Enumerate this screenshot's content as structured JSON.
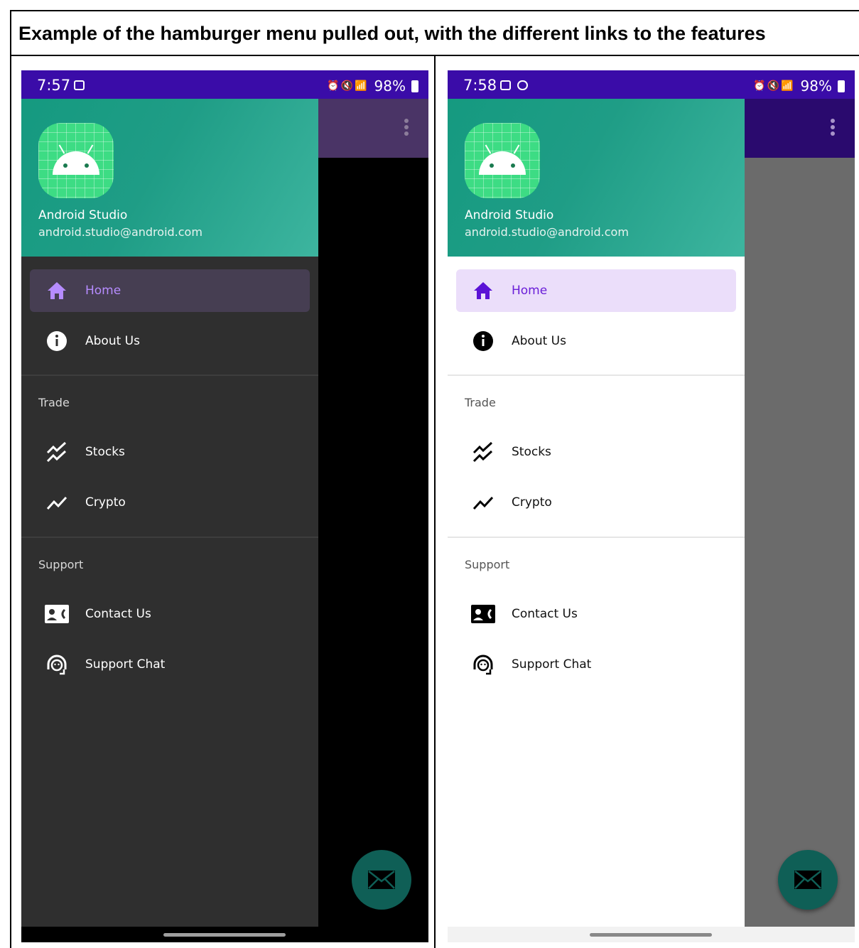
{
  "caption": "Example of the hamburger menu pulled out, with the different links to the features",
  "colors": {
    "status_bar": "#3a0ca8",
    "header": "#1f9d86",
    "fab": "#0f5f56",
    "active_dark": "#b68cff",
    "active_light": "#6a1ed8"
  },
  "screens": [
    {
      "theme": "dark",
      "status": {
        "time": "7:57",
        "battery": "98%"
      },
      "header": {
        "name": "Android Studio",
        "email": "android.studio@android.com"
      },
      "menu": {
        "home": "Home",
        "about": "About Us",
        "section_trade": "Trade",
        "stocks": "Stocks",
        "crypto": "Crypto",
        "section_support": "Support",
        "contact": "Contact Us",
        "chat": "Support Chat"
      }
    },
    {
      "theme": "light",
      "status": {
        "time": "7:58",
        "battery": "98%"
      },
      "header": {
        "name": "Android Studio",
        "email": "android.studio@android.com"
      },
      "menu": {
        "home": "Home",
        "about": "About Us",
        "section_trade": "Trade",
        "stocks": "Stocks",
        "crypto": "Crypto",
        "section_support": "Support",
        "contact": "Contact Us",
        "chat": "Support Chat"
      }
    }
  ],
  "icons": [
    "home-icon",
    "info-icon",
    "stocks-chart-icon",
    "crypto-chart-icon",
    "contact-card-icon",
    "support-headset-icon",
    "mail-icon",
    "more-vert-icon"
  ]
}
